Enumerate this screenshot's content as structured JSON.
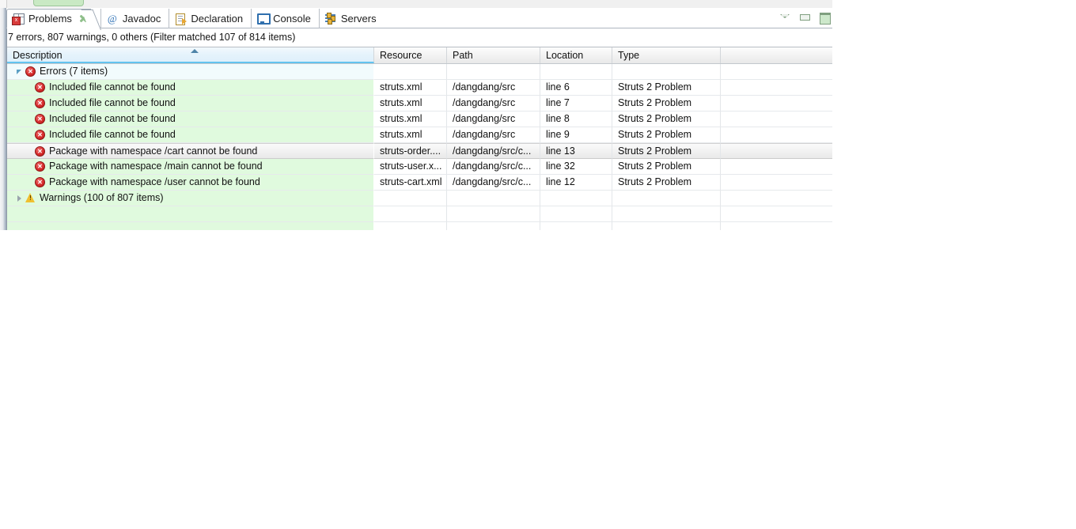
{
  "view": {
    "title": "Problems",
    "summary": "7 errors, 807 warnings, 0 others (Filter matched 107 of 814 items)"
  },
  "tabs": [
    {
      "label": "Problems",
      "icon": "problems-icon",
      "active": true,
      "closable": true
    },
    {
      "label": "Javadoc",
      "icon": "javadoc-icon",
      "active": false,
      "closable": false
    },
    {
      "label": "Declaration",
      "icon": "declaration-icon",
      "active": false,
      "closable": false
    },
    {
      "label": "Console",
      "icon": "console-icon",
      "active": false,
      "closable": false
    },
    {
      "label": "Servers",
      "icon": "servers-icon",
      "active": false,
      "closable": false
    }
  ],
  "toolbar": {
    "view_menu": "view-menu-icon",
    "minimize": "minimize-icon",
    "maximize": "maximize-icon"
  },
  "table": {
    "columns": [
      {
        "key": "description",
        "label": "Description",
        "sorted": true,
        "sort_dir": "asc"
      },
      {
        "key": "resource",
        "label": "Resource",
        "sorted": false,
        "sort_dir": ""
      },
      {
        "key": "path",
        "label": "Path",
        "sorted": false,
        "sort_dir": ""
      },
      {
        "key": "location",
        "label": "Location",
        "sorted": false,
        "sort_dir": ""
      },
      {
        "key": "type",
        "label": "Type",
        "sorted": false,
        "sort_dir": ""
      },
      {
        "key": "extra",
        "label": "",
        "sorted": false,
        "sort_dir": ""
      }
    ],
    "rows": [
      {
        "kind": "group",
        "twisty": "expanded",
        "icon": "error-icon",
        "selected": false,
        "description": "Errors (7 items)",
        "resource": "",
        "path": "",
        "location": "",
        "type": ""
      },
      {
        "kind": "item",
        "twisty": "",
        "icon": "error-icon",
        "selected": false,
        "description": "Included file cannot be found",
        "resource": "struts.xml",
        "path": "/dangdang/src",
        "location": "line 6",
        "type": "Struts 2 Problem"
      },
      {
        "kind": "item",
        "twisty": "",
        "icon": "error-icon",
        "selected": false,
        "description": "Included file cannot be found",
        "resource": "struts.xml",
        "path": "/dangdang/src",
        "location": "line 7",
        "type": "Struts 2 Problem"
      },
      {
        "kind": "item",
        "twisty": "",
        "icon": "error-icon",
        "selected": false,
        "description": "Included file cannot be found",
        "resource": "struts.xml",
        "path": "/dangdang/src",
        "location": "line 8",
        "type": "Struts 2 Problem"
      },
      {
        "kind": "item",
        "twisty": "",
        "icon": "error-icon",
        "selected": false,
        "description": "Included file cannot be found",
        "resource": "struts.xml",
        "path": "/dangdang/src",
        "location": "line 9",
        "type": "Struts 2 Problem"
      },
      {
        "kind": "item",
        "twisty": "",
        "icon": "error-icon",
        "selected": true,
        "description": "Package with namespace /cart cannot be found",
        "resource": "struts-order....",
        "path": "/dangdang/src/c...",
        "location": "line 13",
        "type": "Struts 2 Problem"
      },
      {
        "kind": "item",
        "twisty": "",
        "icon": "error-icon",
        "selected": false,
        "description": "Package with namespace /main cannot be found",
        "resource": "struts-user.x...",
        "path": "/dangdang/src/c...",
        "location": "line 32",
        "type": "Struts 2 Problem"
      },
      {
        "kind": "item",
        "twisty": "",
        "icon": "error-icon",
        "selected": false,
        "description": "Package with namespace /user cannot be found",
        "resource": "struts-cart.xml",
        "path": "/dangdang/src/c...",
        "location": "line 12",
        "type": "Struts 2 Problem"
      },
      {
        "kind": "group-warn",
        "twisty": "collapsed",
        "icon": "warning-icon",
        "selected": false,
        "description": "Warnings (100 of 807 items)",
        "resource": "",
        "path": "",
        "location": "",
        "type": ""
      },
      {
        "kind": "empty",
        "twisty": "",
        "icon": "",
        "selected": false,
        "description": "",
        "resource": "",
        "path": "",
        "location": "",
        "type": ""
      },
      {
        "kind": "empty",
        "twisty": "",
        "icon": "",
        "selected": false,
        "description": "",
        "resource": "",
        "path": "",
        "location": "",
        "type": ""
      }
    ]
  },
  "colors": {
    "row_green": "#e0fade",
    "group_blue": "#f2fbfd",
    "error_red": "#d62b2b",
    "warning_amber": "#f0c030",
    "sort_header_blue": "#dff0fb",
    "sort_underline": "#63c3ef"
  }
}
